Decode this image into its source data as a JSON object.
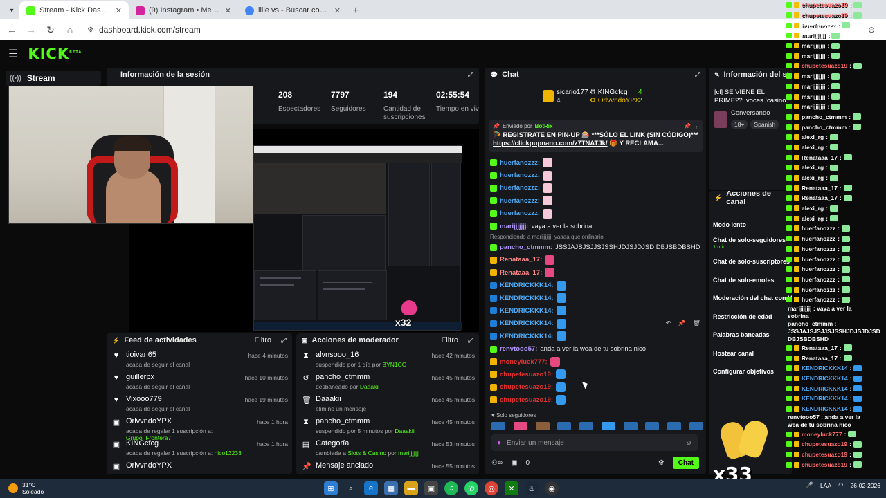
{
  "browser": {
    "tabs": [
      {
        "title": "Stream - Kick Dashboard",
        "color": "#53fc18",
        "active": true
      },
      {
        "title": "(9) Instagram • Mensajes",
        "color": "#d6249f",
        "active": false
      },
      {
        "title": "lille vs - Buscar con Google",
        "color": "#4285f4",
        "active": false
      }
    ],
    "url": "dashboard.kick.com/stream"
  },
  "kick": {
    "logo": "KICK",
    "logo_sup": "BETA",
    "nav_stream": "Stream"
  },
  "session": {
    "title": "Información de la sesión",
    "stats": [
      {
        "value": "208",
        "label": "Espectadores"
      },
      {
        "value": "7797",
        "label": "Seguidores"
      },
      {
        "value": "194",
        "label": "Cantidad de suscripciones"
      },
      {
        "value": "02:55:54",
        "label": "Tiempo en vivo"
      }
    ]
  },
  "preview": {
    "multiplier": "x32"
  },
  "feed": {
    "title": "Feed de actividades",
    "filter": "Filtro",
    "items": [
      {
        "name": "tioivan65",
        "desc": "acaba de seguir el canal",
        "extra": "",
        "time": "hace 4 minutos",
        "icon": "♥"
      },
      {
        "name": "guillerpx",
        "desc": "acaba de seguir el canal",
        "extra": "",
        "time": "hace 10 minutos",
        "icon": "♥"
      },
      {
        "name": "Vixooo779",
        "desc": "acaba de seguir el canal",
        "extra": "",
        "time": "hace 19 minutos",
        "icon": "♥"
      },
      {
        "name": "OrlvvndoYPX",
        "desc": "acaba de regalar 1 suscripción a: ",
        "extra": "Grupo_Frontera7",
        "time": "hace 1 hora",
        "icon": "▣"
      },
      {
        "name": "KINGcfcg",
        "desc": "acaba de regalar 1 suscripción a: ",
        "extra": "nico12233",
        "time": "hace 1 hora",
        "icon": "▣"
      },
      {
        "name": "OrlvvndoYPX",
        "desc": "",
        "extra": "",
        "time": "",
        "icon": "▣"
      }
    ]
  },
  "mod": {
    "title": "Acciones de moderador",
    "filter": "Filtro",
    "items": [
      {
        "name": "alvnsooo_16",
        "desc": "suspendido por 1 día por ",
        "extra": "BYN1CO",
        "time": "hace 42 minutos",
        "icon": "⧗"
      },
      {
        "name": "pancho_ctmmm",
        "desc": "desbaneado por ",
        "extra": "Daaakii",
        "time": "hace 45 minutos",
        "icon": "↺"
      },
      {
        "name": "Daaakii",
        "desc": "eliminó un mensaje",
        "extra": "",
        "time": "hace 45 minutos",
        "icon": "🗑"
      },
      {
        "name": "pancho_ctmmm",
        "desc": "suspendido por 5 minutos por ",
        "extra": "Daaakii",
        "time": "hace 45 minutos",
        "icon": "⧗"
      },
      {
        "name": "Categoría",
        "desc": "cambiada a ",
        "extra": "Slots & Casino",
        "extra2": " por ",
        "extra3": "marijjjjjjj",
        "time": "hace 53 minutos",
        "icon": "▤"
      },
      {
        "name": "Mensaje anclado",
        "desc": "",
        "extra": "",
        "time": "hace 55 minutos",
        "icon": "📌"
      }
    ]
  },
  "chat": {
    "title": "Chat",
    "leaders": [
      {
        "name": "sicario177",
        "count": "4"
      },
      {
        "name": "KINGcfcg",
        "count": "4"
      },
      {
        "name": "OrlvvndoYPX",
        "count": "2"
      }
    ],
    "pinned": {
      "by_label": "Enviado por",
      "by": "BotRix",
      "text": "🪂 REGISTRATE EN PIN-UP 🎰 ***SÓLO EL LINK (SIN CÓDIGO)*** ",
      "link": "https://clickpupnano.com/z7TNATJk/",
      "tail": " 🎁 Y RECLAMA..."
    },
    "messages": [
      {
        "user": "huerfanozzz:",
        "color": "#4dabf7",
        "msg": "",
        "emote": "#f6c9d9"
      },
      {
        "user": "huerfanozzz:",
        "color": "#4dabf7",
        "msg": "",
        "emote": "#f6c9d9"
      },
      {
        "user": "huerfanozzz:",
        "color": "#4dabf7",
        "msg": "",
        "emote": "#f6c9d9"
      },
      {
        "user": "huerfanozzz:",
        "color": "#4dabf7",
        "msg": "",
        "emote": "#f6c9d9"
      },
      {
        "user": "huerfanozzz:",
        "color": "#4dabf7",
        "msg": "",
        "emote": "#f6c9d9"
      },
      {
        "user": "marijjjjjjj:",
        "color": "#b197fc",
        "msg": "vaya a ver la sobrina",
        "emote": ""
      },
      {
        "user": "pancho_ctmmm:",
        "color": "#b197fc",
        "msg": "JSSJAJSJSJJSJSSHJDJSJDJSD DBJSBDBSHD",
        "emote": "",
        "reply": "Respondiendo a marijjjjjjj: yaaaa que ordinario"
      },
      {
        "user": "Renataaa_17:",
        "color": "#ff8787",
        "msg": "",
        "emote": "#e64980"
      },
      {
        "user": "Renataaa_17:",
        "color": "#ff8787",
        "msg": "",
        "emote": "#e64980"
      },
      {
        "user": "KENDRICKKK14:",
        "color": "#4dabf7",
        "msg": "",
        "emote": "#339af0"
      },
      {
        "user": "KENDRICKKK14:",
        "color": "#4dabf7",
        "msg": "",
        "emote": "#339af0"
      },
      {
        "user": "KENDRICKKK14:",
        "color": "#4dabf7",
        "msg": "",
        "emote": "#339af0"
      },
      {
        "user": "KENDRICKKK14:",
        "color": "#4dabf7",
        "msg": "",
        "emote": "#339af0"
      },
      {
        "user": "KENDRICKKK14:",
        "color": "#4dabf7",
        "msg": "",
        "emote": "#339af0"
      },
      {
        "user": "renvtooo57:",
        "color": "#b197fc",
        "msg": "anda a ver la wea de tu sobrina nico",
        "emote": ""
      },
      {
        "user": "moneyluck777:",
        "color": "#e03131",
        "msg": "",
        "emote": "#e64980"
      },
      {
        "user": "chupetesuazo19:",
        "color": "#e03131",
        "msg": "",
        "emote": "#339af0"
      },
      {
        "user": "chupetesuazo19:",
        "color": "#e03131",
        "msg": "",
        "emote": "#339af0"
      },
      {
        "user": "chupetesuazo19:",
        "color": "#e03131",
        "msg": "",
        "emote": "#339af0"
      }
    ],
    "solo_label": "Solo seguidores",
    "input_placeholder": "Enviar un mensaje",
    "points": "0",
    "send_label": "Chat"
  },
  "stream_info": {
    "title": "Información del stream",
    "stream_title": "[cl] SE VIENE EL PRIME?? !voces !casino",
    "category": "Conversando",
    "tags": [
      "18+",
      "Spanish"
    ]
  },
  "actions": {
    "title": "Acciones de canal",
    "items": [
      {
        "label": "Modo lento",
        "sub": ""
      },
      {
        "label": "Chat de solo-seguidores",
        "sub": "1 min"
      },
      {
        "label": "Chat de solo-suscriptores",
        "sub": ""
      },
      {
        "label": "Chat de solo-emotes",
        "sub": ""
      },
      {
        "label": "Moderación del chat con IA",
        "sub": ""
      },
      {
        "label": "Restricción de edad",
        "sub": ""
      },
      {
        "label": "Palabras baneadas",
        "sub": ""
      },
      {
        "label": "Hostear canal",
        "sub": ""
      },
      {
        "label": "Configurar objetivos",
        "sub": ""
      }
    ]
  },
  "overlay": {
    "lines": [
      {
        "user": "chupetesuazo19",
        "color": "#ff6b6b",
        "text": ":"
      },
      {
        "user": "chupetesuazo19",
        "color": "#ff6b6b",
        "text": ":"
      },
      {
        "user": "huerfanozzz",
        "color": "#ffffff",
        "text": ":"
      },
      {
        "user": "marijjjjjjj",
        "color": "#ffffff",
        "text": ":"
      },
      {
        "user": "marijjjjjjj",
        "color": "#ffffff",
        "text": ":"
      },
      {
        "user": "marijjjjjjj",
        "color": "#ffffff",
        "text": ":"
      },
      {
        "user": "chupetesuazo19",
        "color": "#ff6b6b",
        "text": ":"
      },
      {
        "user": "marijjjjjjj",
        "color": "#ffffff",
        "text": ":"
      },
      {
        "user": "marijjjjjjj",
        "color": "#ffffff",
        "text": ":"
      },
      {
        "user": "marijjjjjjj",
        "color": "#ffffff",
        "text": ":"
      },
      {
        "user": "marijjjjjjj",
        "color": "#ffffff",
        "text": ":"
      },
      {
        "user": "pancho_ctmmm",
        "color": "#ffffff",
        "text": ":"
      },
      {
        "user": "pancho_ctmmm",
        "color": "#ffffff",
        "text": ":"
      },
      {
        "user": "alexi_rg",
        "color": "#ffffff",
        "text": ":"
      },
      {
        "user": "alexi_rg",
        "color": "#ffffff",
        "text": ":"
      },
      {
        "user": "Renataaa_17",
        "color": "#ffffff",
        "text": ":"
      },
      {
        "user": "alexi_rg",
        "color": "#ffffff",
        "text": ":"
      },
      {
        "user": "alexi_rg",
        "color": "#ffffff",
        "text": ":"
      },
      {
        "user": "Renataaa_17",
        "color": "#ffffff",
        "text": ":"
      },
      {
        "user": "Renataaa_17",
        "color": "#ffffff",
        "text": ":"
      },
      {
        "user": "alexi_rg",
        "color": "#ffffff",
        "text": ":"
      },
      {
        "user": "alexi_rg",
        "color": "#ffffff",
        "text": ":"
      },
      {
        "user": "huerfanozzz",
        "color": "#ffffff",
        "text": ":"
      },
      {
        "user": "huerfanozzz",
        "color": "#ffffff",
        "text": ":"
      },
      {
        "user": "huerfanozzz",
        "color": "#ffffff",
        "text": ":"
      },
      {
        "user": "huerfanozzz",
        "color": "#ffffff",
        "text": ":"
      },
      {
        "user": "huerfanozzz",
        "color": "#ffffff",
        "text": ":"
      },
      {
        "user": "huerfanozzz",
        "color": "#ffffff",
        "text": ":"
      },
      {
        "user": "huerfanozzz",
        "color": "#ffffff",
        "text": ":"
      },
      {
        "user": "huerfanozzz",
        "color": "#ffffff",
        "text": ":"
      }
    ],
    "marij_msg_a": "marijjjjjjj : vaya a ver la",
    "marij_msg_b": "sobrina",
    "pancho_msg_a": "pancho_ctmmm :",
    "pancho_msg_b": "JSSJAJSJSJJSJSSHJDJSJDJSD",
    "pancho_msg_c": "DBJSBDBSHD",
    "lines2": [
      {
        "user": "Renataaa_17",
        "color": "#ffffff"
      },
      {
        "user": "Renataaa_17",
        "color": "#ffffff"
      },
      {
        "user": "KENDRICKKK14",
        "color": "#4dabf7"
      },
      {
        "user": "KENDRICKKK14",
        "color": "#4dabf7"
      },
      {
        "user": "KENDRICKKK14",
        "color": "#4dabf7"
      },
      {
        "user": "KENDRICKKK14",
        "color": "#4dabf7"
      },
      {
        "user": "KENDRICKKK14",
        "color": "#4dabf7"
      }
    ],
    "renv_a": "renvtooo57 : anda a ver la",
    "renv_b": "wea de tu sobrina nico",
    "lines3": [
      {
        "user": "moneyluck777",
        "color": "#ff6b6b"
      },
      {
        "user": "chupetesuazo19",
        "color": "#ff6b6b"
      },
      {
        "user": "chupetesuazo19",
        "color": "#ff6b6b"
      },
      {
        "user": "chupetesuazo19",
        "color": "#ff6b6b"
      }
    ],
    "x33": "x33"
  },
  "taskbar": {
    "temp": "31°C",
    "weather": "Soleado",
    "lang": "LAA",
    "time": "",
    "date": "26-02-2026"
  }
}
